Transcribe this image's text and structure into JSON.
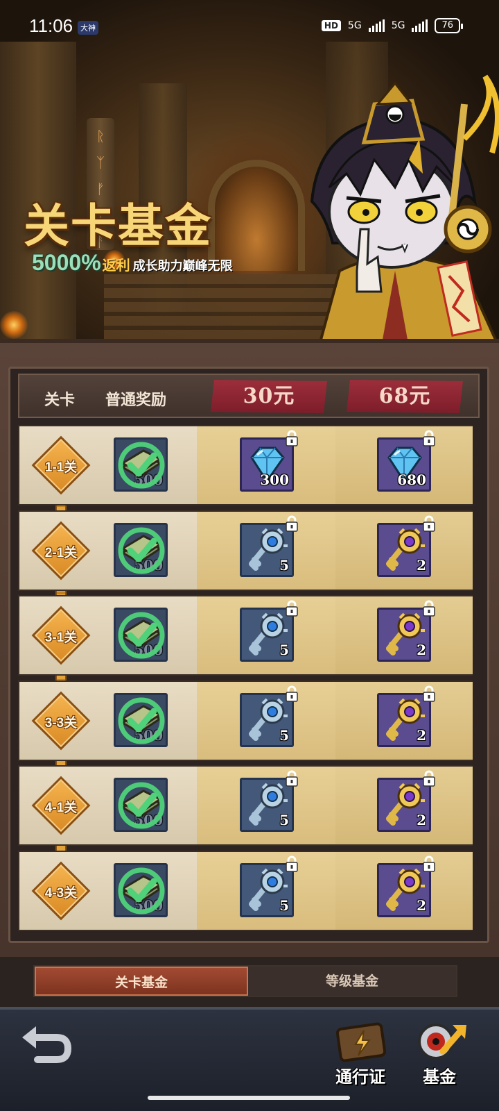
{
  "status_bar": {
    "time": "11:06",
    "badge": "大神",
    "hd": "HD",
    "net1": "5G",
    "net2": "5G",
    "battery": "76"
  },
  "banner": {
    "title": "关卡基金",
    "percent": "5000%",
    "rebate": "返利",
    "tagline": "成长助力巅峰无限"
  },
  "table_header": {
    "stage_col": "关卡",
    "normal_col": "普通奖励",
    "tier1_price": "30元",
    "tier2_price": "68元"
  },
  "rows": [
    {
      "stage": "1-1关",
      "free_qty": "500",
      "tier1_qty": "300",
      "tier2_qty": "680",
      "tier1_icon": "blue-diamond-icon",
      "tier2_icon": "blue-diamond-icon"
    },
    {
      "stage": "2-1关",
      "free_qty": "500",
      "tier1_qty": "5",
      "tier2_qty": "2",
      "tier1_icon": "silver-key-icon",
      "tier2_icon": "gold-key-icon"
    },
    {
      "stage": "3-1关",
      "free_qty": "500",
      "tier1_qty": "5",
      "tier2_qty": "2",
      "tier1_icon": "silver-key-icon",
      "tier2_icon": "gold-key-icon"
    },
    {
      "stage": "3-3关",
      "free_qty": "500",
      "tier1_qty": "5",
      "tier2_qty": "2",
      "tier1_icon": "silver-key-icon",
      "tier2_icon": "gold-key-icon"
    },
    {
      "stage": "4-1关",
      "free_qty": "500",
      "tier1_qty": "5",
      "tier2_qty": "2",
      "tier1_icon": "silver-key-icon",
      "tier2_icon": "gold-key-icon"
    },
    {
      "stage": "4-3关",
      "free_qty": "500",
      "tier1_qty": "5",
      "tier2_qty": "2",
      "tier1_icon": "silver-key-icon",
      "tier2_icon": "gold-key-icon"
    }
  ],
  "tabs": {
    "active": "关卡基金",
    "inactive": "等级基金"
  },
  "bottom_nav": {
    "pass_label": "通行证",
    "fund_label": "基金"
  },
  "colors": {
    "title_gold": "#f7d678",
    "percent_green": "#9be0b8",
    "price_red": "#9c2e3a",
    "claimed_check": "#4fd27a",
    "tab_active": "#a34a32"
  }
}
